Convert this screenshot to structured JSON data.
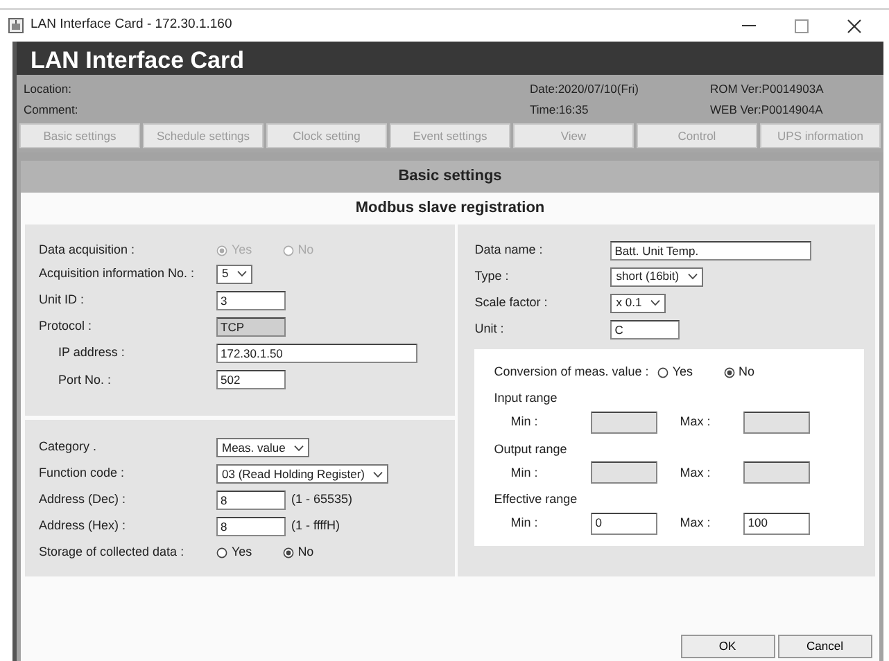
{
  "window": {
    "title": "LAN Interface Card - 172.30.1.160"
  },
  "app_title": "LAN Interface Card",
  "info": {
    "location": "Location:",
    "comment": "Comment:",
    "date": "Date:2020/07/10(Fri)",
    "time": "Time:16:35",
    "rom_ver": "ROM Ver:P0014903A",
    "web_ver": "WEB Ver:P0014904A"
  },
  "tabs": [
    {
      "label": "Basic settings",
      "selected": false
    },
    {
      "label": "Schedule settings",
      "selected": false
    },
    {
      "label": "Clock setting",
      "selected": false
    },
    {
      "label": "Event settings",
      "selected": false
    },
    {
      "label": "View",
      "selected": false
    },
    {
      "label": "Control",
      "selected": false
    },
    {
      "label": "UPS information",
      "selected": false
    }
  ],
  "section_title": "Basic settings",
  "form_title": "Modbus slave registration",
  "left_top": [
    {
      "kind": "radio",
      "label": "Data acquisition :",
      "disabled": true,
      "options": [
        {
          "label": "Yes",
          "selected": true
        },
        {
          "label": "No",
          "selected": false
        }
      ]
    },
    {
      "kind": "select",
      "label": "Acquisition information No. :",
      "value": "5"
    },
    {
      "kind": "input",
      "label": "Unit ID :",
      "value": "3"
    },
    {
      "kind": "readonly",
      "label": "Protocol :",
      "value": "TCP",
      "children": [
        {
          "kind": "wide_input",
          "label": "IP address :",
          "value": "172.30.1.50"
        },
        {
          "kind": "input",
          "label": "Port No. :",
          "value": "502"
        }
      ]
    }
  ],
  "left_bottom": [
    {
      "kind": "select",
      "label": "Category .",
      "value": "Meas. value"
    },
    {
      "kind": "select",
      "label": "Function code :",
      "value": "03 (Read Holding Register)"
    },
    {
      "kind": "input",
      "label": "Address (Dec) :",
      "value": "8",
      "hint": "(1 - 65535)"
    },
    {
      "kind": "input",
      "label": "Address (Hex) :",
      "value": "8",
      "hint": "(1 - ffffH)"
    },
    {
      "kind": "radio",
      "label": "Storage of collected data :",
      "disabled": false,
      "options": [
        {
          "label": "Yes",
          "selected": false
        },
        {
          "label": "No",
          "selected": true
        }
      ]
    }
  ],
  "right": [
    {
      "kind": "wide_input",
      "label": "Data name :",
      "value": "Batt. Unit Temp."
    },
    {
      "kind": "select",
      "label": "Type :",
      "value": "short (16bit)"
    },
    {
      "kind": "select",
      "label": "Scale factor :",
      "value": "x 0.1"
    },
    {
      "kind": "input",
      "label": "Unit :",
      "value": "C"
    }
  ],
  "conversion": {
    "label": "Conversion of meas. value :",
    "options": [
      {
        "label": "Yes",
        "selected": false
      },
      {
        "label": "No",
        "selected": true
      }
    ],
    "ranges": [
      {
        "title": "Input range",
        "min_label": "Min :",
        "max_label": "Max :",
        "disabled": true
      },
      {
        "title": "Output range",
        "min_label": "Min :",
        "max_label": "Max :",
        "disabled": true
      },
      {
        "title": "Effective range",
        "min_label": "Min :",
        "max_label": "Max :",
        "disabled": false,
        "min": "0",
        "max": "100"
      }
    ]
  },
  "buttons": [
    "OK",
    "Cancel"
  ]
}
